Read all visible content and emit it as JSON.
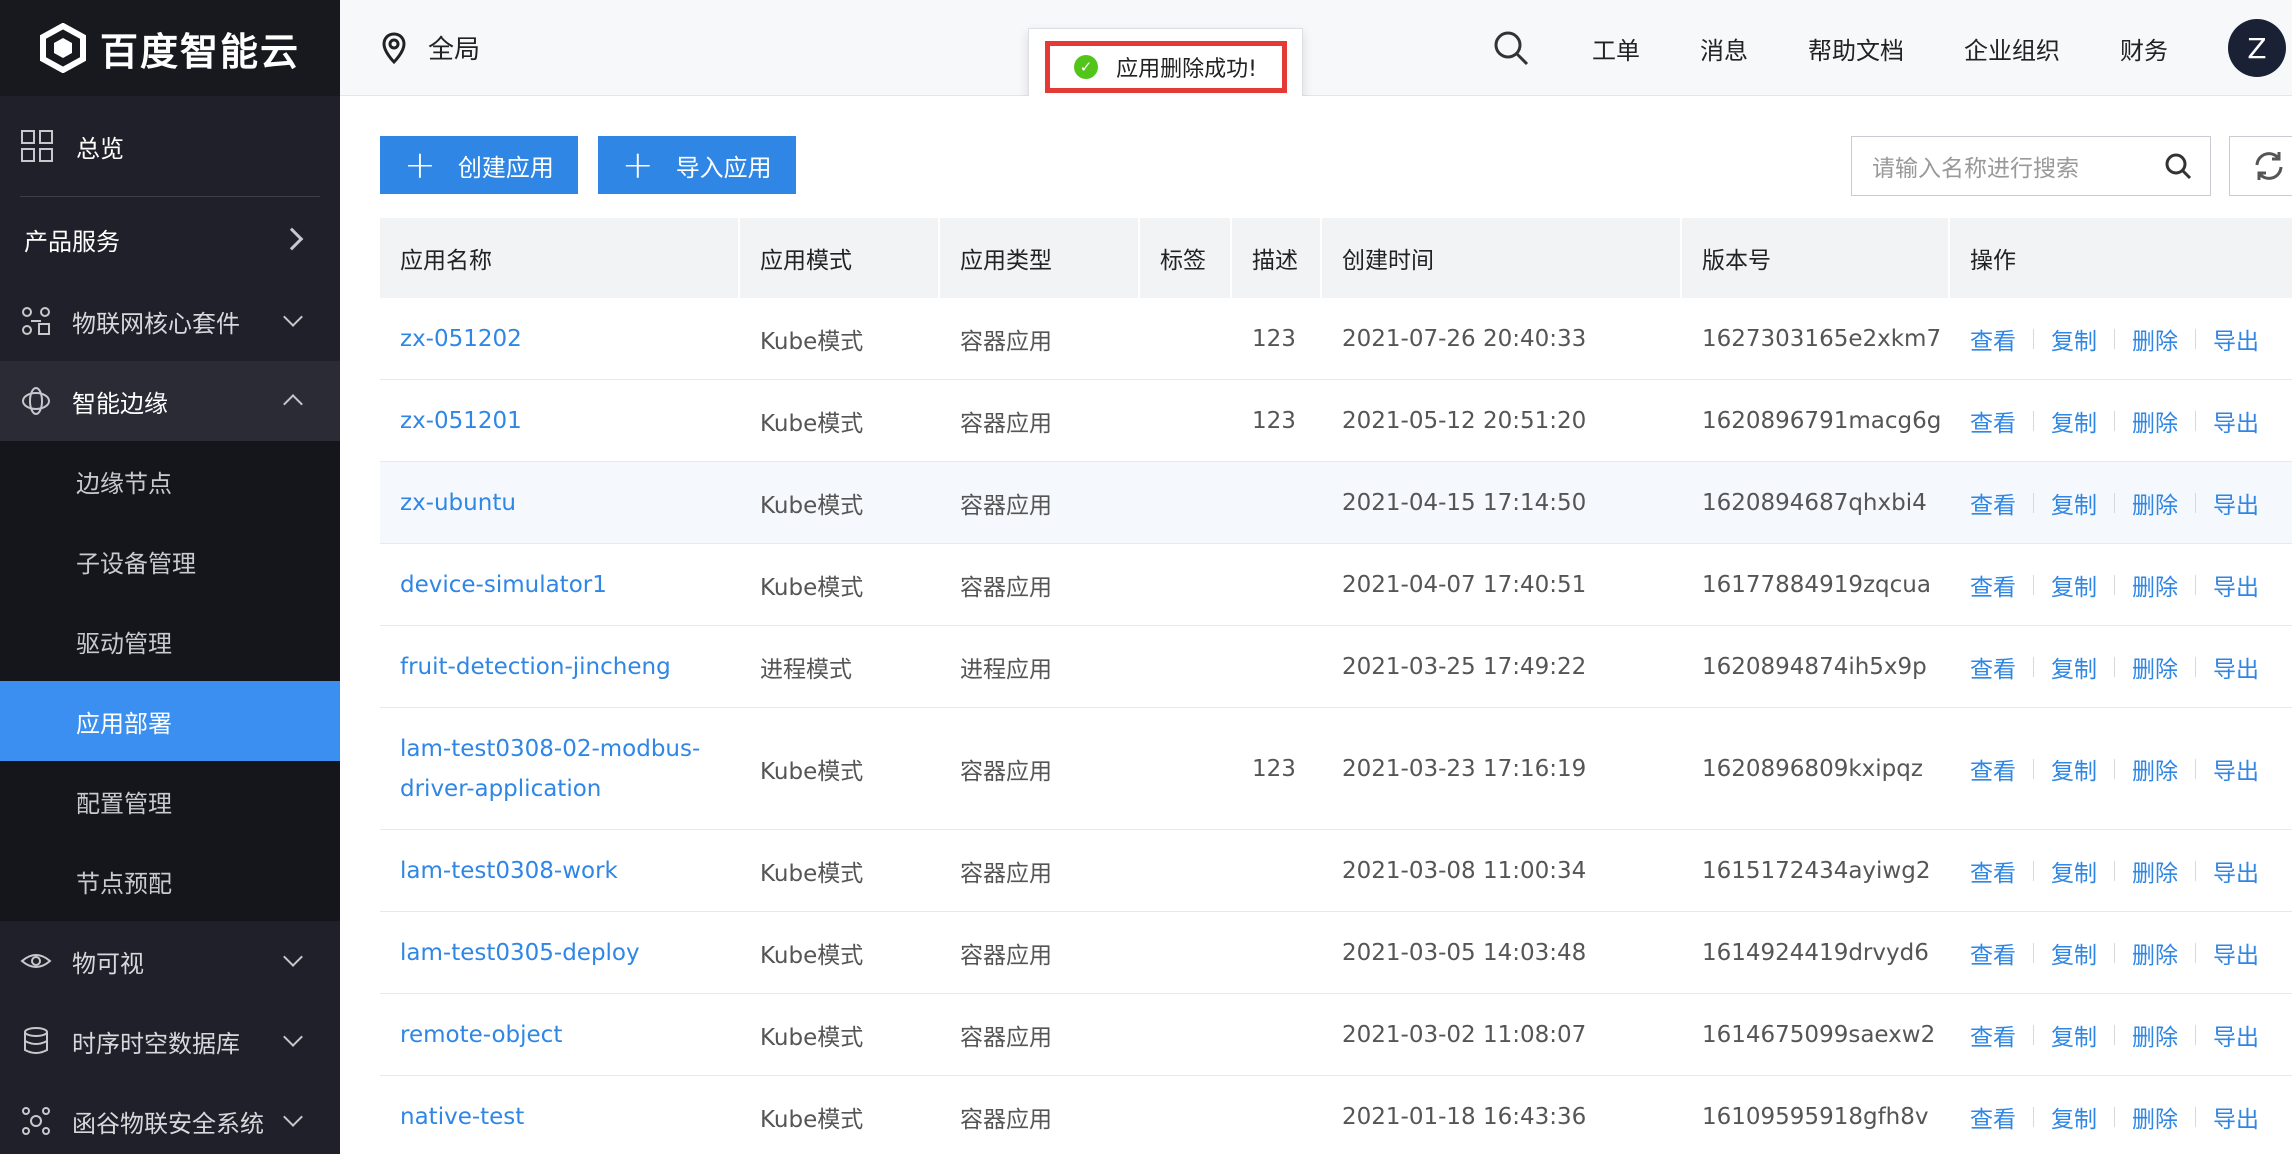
{
  "brand": {
    "name": "百度智能云"
  },
  "sidebar": {
    "overview": "总览",
    "product_services": "产品服务",
    "items": [
      {
        "label": "物联网核心套件",
        "icon": "iot-core-icon"
      },
      {
        "label": "智能边缘",
        "icon": "edge-icon"
      }
    ],
    "sub_items": [
      "边缘节点",
      "子设备管理",
      "驱动管理",
      "应用部署",
      "配置管理",
      "节点预配"
    ],
    "bottom_items": [
      {
        "label": "物可视",
        "icon": "eye-icon"
      },
      {
        "label": "时序时空数据库",
        "icon": "database-icon"
      },
      {
        "label": "函谷物联安全系统",
        "icon": "security-icon"
      }
    ]
  },
  "header": {
    "region": "全局",
    "links": [
      "工单",
      "消息",
      "帮助文档",
      "企业组织",
      "财务"
    ],
    "avatar": "Z"
  },
  "toast": {
    "message": "应用删除成功!"
  },
  "toolbar": {
    "create_label": "创建应用",
    "import_label": "导入应用",
    "search_placeholder": "请输入名称进行搜索"
  },
  "table": {
    "headers": [
      "应用名称",
      "应用模式",
      "应用类型",
      "标签",
      "描述",
      "创建时间",
      "版本号",
      "操作"
    ],
    "actions": [
      "查看",
      "复制",
      "删除",
      "导出"
    ],
    "rows": [
      {
        "name": "zx-051202",
        "mode": "Kube模式",
        "type": "容器应用",
        "tag": "",
        "desc": "123",
        "created": "2021-07-26 20:40:33",
        "version": "1627303165e2xkm7"
      },
      {
        "name": "zx-051201",
        "mode": "Kube模式",
        "type": "容器应用",
        "tag": "",
        "desc": "123",
        "created": "2021-05-12 20:51:20",
        "version": "1620896791macg6g"
      },
      {
        "name": "zx-ubuntu",
        "mode": "Kube模式",
        "type": "容器应用",
        "tag": "",
        "desc": "",
        "created": "2021-04-15 17:14:50",
        "version": "1620894687qhxbi4"
      },
      {
        "name": "device-simulator1",
        "mode": "Kube模式",
        "type": "容器应用",
        "tag": "",
        "desc": "",
        "created": "2021-04-07 17:40:51",
        "version": "16177884919zqcua"
      },
      {
        "name": "fruit-detection-jincheng",
        "mode": "进程模式",
        "type": "进程应用",
        "tag": "",
        "desc": "",
        "created": "2021-03-25 17:49:22",
        "version": "1620894874ih5x9p"
      },
      {
        "name": "lam-test0308-02-modbus-driver-application",
        "mode": "Kube模式",
        "type": "容器应用",
        "tag": "",
        "desc": "123",
        "created": "2021-03-23 17:16:19",
        "version": "1620896809kxipqz"
      },
      {
        "name": "lam-test0308-work",
        "mode": "Kube模式",
        "type": "容器应用",
        "tag": "",
        "desc": "",
        "created": "2021-03-08 11:00:34",
        "version": "1615172434ayiwg2"
      },
      {
        "name": "lam-test0305-deploy",
        "mode": "Kube模式",
        "type": "容器应用",
        "tag": "",
        "desc": "",
        "created": "2021-03-05 14:03:48",
        "version": "1614924419drvyd6"
      },
      {
        "name": "remote-object",
        "mode": "Kube模式",
        "type": "容器应用",
        "tag": "",
        "desc": "",
        "created": "2021-03-02 11:08:07",
        "version": "1614675099saexw2"
      },
      {
        "name": "native-test",
        "mode": "Kube模式",
        "type": "容器应用",
        "tag": "",
        "desc": "",
        "created": "2021-01-18 16:43:36",
        "version": "16109595918gfh8v"
      }
    ]
  }
}
